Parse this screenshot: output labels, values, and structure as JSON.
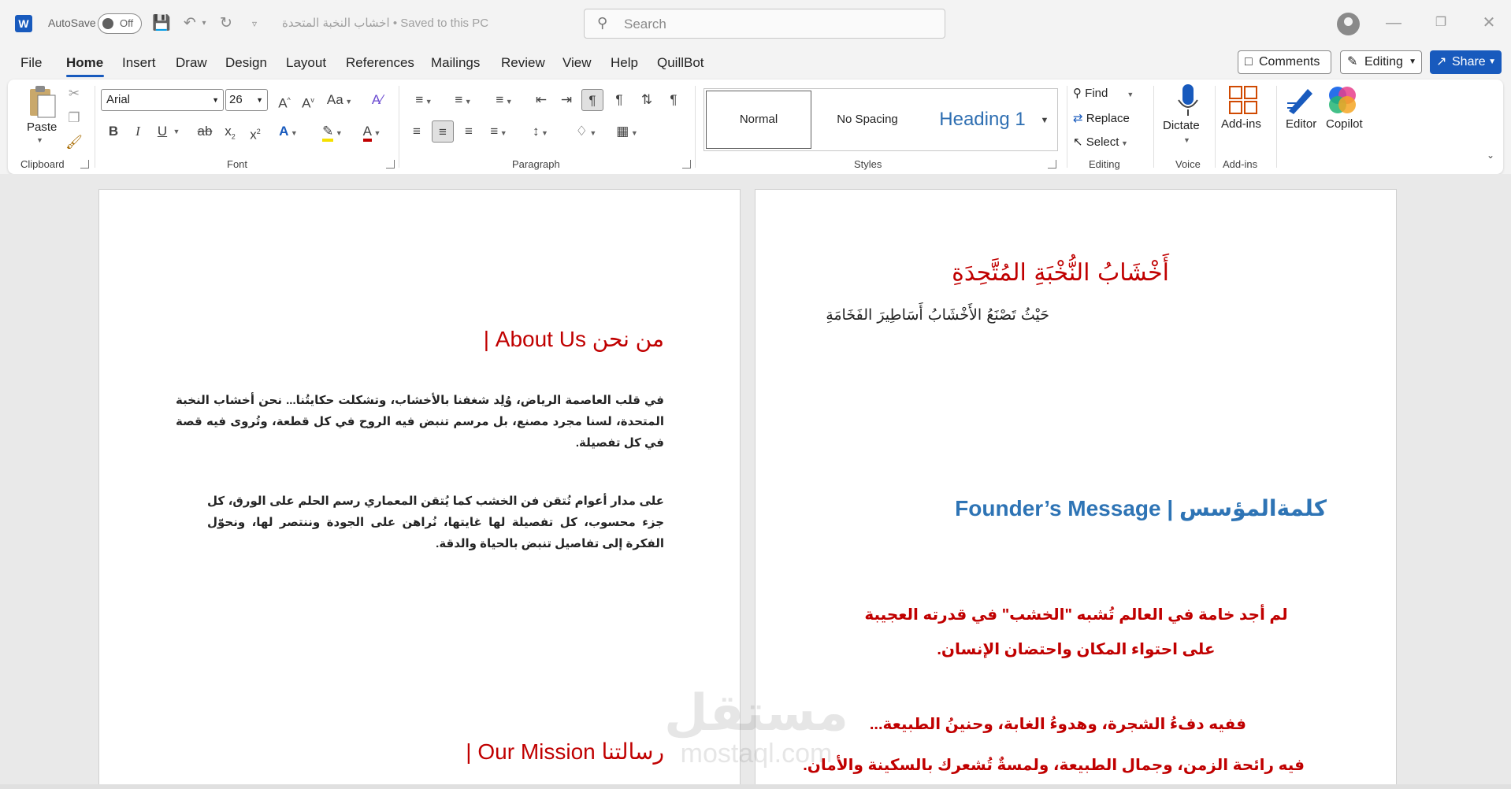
{
  "titlebar": {
    "autosave_label": "AutoSave",
    "autosave_state": "Off",
    "doc_title": "اخشاب النخبة المتحدة  •  Saved to this PC",
    "search_placeholder": "Search"
  },
  "menu": {
    "tabs": [
      "File",
      "Home",
      "Insert",
      "Draw",
      "Design",
      "Layout",
      "References",
      "Mailings",
      "Review",
      "View",
      "Help",
      "QuillBot"
    ],
    "active_tab": "Home",
    "comments_label": "Comments",
    "editing_label": "Editing",
    "share_label": "Share"
  },
  "ribbon": {
    "clipboard": {
      "paste_label": "Paste",
      "group_label": "Clipboard"
    },
    "font": {
      "font_name": "Arial",
      "font_size": "26",
      "group_label": "Font",
      "change_case": "Aa"
    },
    "paragraph": {
      "group_label": "Paragraph"
    },
    "styles": {
      "normal": "Normal",
      "no_spacing": "No Spacing",
      "heading1": "Heading 1",
      "group_label": "Styles"
    },
    "editing": {
      "find": "Find",
      "replace": "Replace",
      "select": "Select",
      "group_label": "Editing"
    },
    "voice": {
      "dictate": "Dictate",
      "group_label": "Voice"
    },
    "addins": {
      "addins": "Add-ins",
      "group_label": "Add-ins"
    },
    "editor": "Editor",
    "copilot": "Copilot"
  },
  "page_left": {
    "about_heading": "من نحن About Us |",
    "about_p1": "في قلب العاصمة الرياض، وُلِد شغفنا بالأخشاب، وتشكلت حكايتُنا... نحن أخشاب النخبة المتحدة، لسنا مجرد مصنع، بل مرسم تنبض فيه الروح في كل قطعة، وتُروى فيه قصة في كل تفصيلة.",
    "about_p2": "على مدار أعوام نُتقن فن الخشب كما يُتقن المعماري رسم الحلم على الورق، كل جزء محسوب، كل تفصيلة لها غايتها، نُراهن على الجودة وننتصر لها، ونحوّل الفكرة إلى تفاصيل تنبض بالحياة والدقة.",
    "mission_heading": "رسالتنا Our Mission |"
  },
  "page_right": {
    "title": "أَخْشَابُ النُّخْبَةِ المُتَّحِدَةِ",
    "tagline": "حَيْثُ تَصْنَعُ الأَخْشَابُ أَسَاطِيرَ الفَخَامَةِ",
    "founder_heading": "كلمةالمؤسس | Founder’s Message",
    "quote_p1": "لم أجد خامة في العالم تُشبه \"الخشب\" في قدرته العجيبة على احتواء المكان واحتضان الإنسان.",
    "quote_p2": "ففيه دفءُ الشجرة، وهدوءُ الغابة، وحنينُ الطبيعة...",
    "quote_p3": "فيه رائحة الزمن، وجمال الطبيعة، ولمسةٌ تُشعرك بالسكينة والأمان."
  },
  "watermark": {
    "ar": "مستقل",
    "en": "mostaql.com"
  },
  "colors": {
    "accent": "#185abd",
    "doc_red": "#c00000",
    "doc_blue": "#2e74b5"
  }
}
